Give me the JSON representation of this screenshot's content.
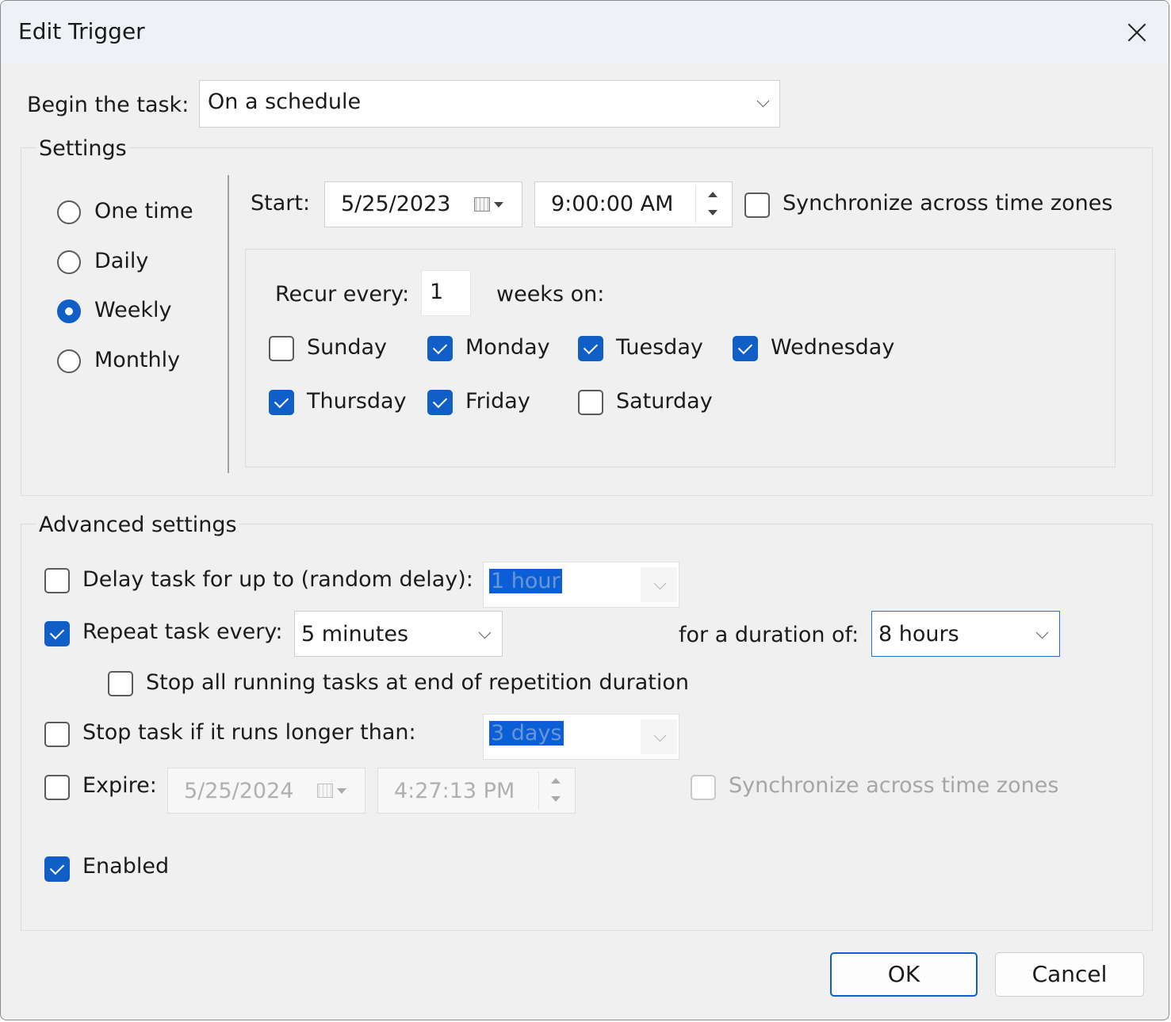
{
  "window": {
    "title": "Edit Trigger"
  },
  "begin_task": {
    "label": "Begin the task:",
    "value": "On a schedule"
  },
  "settings": {
    "group_title": "Settings",
    "schedule_options": [
      {
        "label": "One time",
        "selected": false
      },
      {
        "label": "Daily",
        "selected": false
      },
      {
        "label": "Weekly",
        "selected": true
      },
      {
        "label": "Monthly",
        "selected": false
      }
    ],
    "start_label": "Start:",
    "start_date": "5/25/2023",
    "start_time": "9:00:00 AM",
    "sync_label": "Synchronize across time zones",
    "recur_label": "Recur every:",
    "recur_value": "1",
    "weeks_on_label": "weeks on:",
    "days": [
      {
        "label": "Sunday",
        "checked": false
      },
      {
        "label": "Monday",
        "checked": true
      },
      {
        "label": "Tuesday",
        "checked": true
      },
      {
        "label": "Wednesday",
        "checked": true
      },
      {
        "label": "Thursday",
        "checked": true
      },
      {
        "label": "Friday",
        "checked": true
      },
      {
        "label": "Saturday",
        "checked": false
      }
    ]
  },
  "advanced": {
    "group_title": "Advanced settings",
    "delay_label": "Delay task for up to (random delay):",
    "delay_value": "1 hour",
    "repeat_label": "Repeat task every:",
    "repeat_value": "5 minutes",
    "duration_label": "for a duration of:",
    "duration_value": "8 hours",
    "stop_running_label": "Stop all running tasks at end of repetition duration",
    "stop_longer_label": "Stop task if it runs longer than:",
    "stop_longer_value": "3 days",
    "expire_label": "Expire:",
    "expire_date": "5/25/2024",
    "expire_time": "4:27:13 PM",
    "expire_sync_label": "Synchronize across time zones",
    "enabled_label": "Enabled"
  },
  "buttons": {
    "ok": "OK",
    "cancel": "Cancel"
  },
  "colors": {
    "accent": "#0f5fc7",
    "dialog_bg": "#f0f0f0",
    "titlebar_bg": "#eef1f6"
  }
}
